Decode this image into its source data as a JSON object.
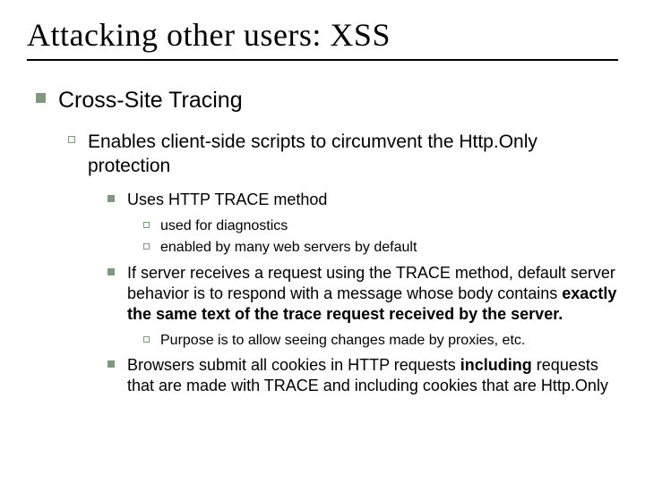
{
  "title": "Attacking other users: XSS",
  "lvl1": {
    "text": "Cross-Site Tracing"
  },
  "lvl2": {
    "text": "Enables client-side scripts to circumvent the Http.Only protection"
  },
  "p1": {
    "head": "Uses HTTP TRACE method",
    "sub1": "used for diagnostics",
    "sub2": "enabled by many web servers by default"
  },
  "p2": {
    "pre": "If server receives a request using the TRACE method, default server behavior is to respond with a message whose body contains ",
    "bold": "exactly the same text of the trace request received by the server.",
    "sub1": "Purpose is to allow seeing changes made by proxies, etc."
  },
  "p3": {
    "pre": "Browsers submit all cookies in HTTP requests ",
    "bold1": "including",
    "mid": " requests that are made with TRACE and including cookies that are Http.Only"
  }
}
